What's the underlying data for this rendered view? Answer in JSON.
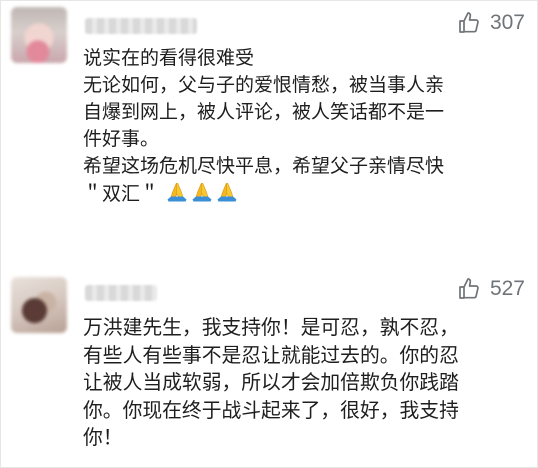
{
  "comments": [
    {
      "likes": "307",
      "lines": [
        "说实在的看得很难受",
        "无论如何，父与子的爱恨情愁，被当事人亲",
        "自爆到网上，被人评论，被人笑话都不是一",
        "件好事。",
        "希望这场危机尽快平息，希望父子亲情尽快",
        "＂双汇＂"
      ],
      "emoji": [
        "folded-hands-icon",
        "folded-hands-icon",
        "folded-hands-icon"
      ]
    },
    {
      "likes": "527",
      "lines": [
        "万洪建先生，我支持你！是可忍，孰不忍，",
        "有些人有些事不是忍让就能过去的。你的忍",
        "让被人当成软弱，所以才会加倍欺负你践踏",
        "你。你现在终于战斗起来了，很好，我支持",
        "你！"
      ]
    }
  ],
  "colors": {
    "text": "#1e1e1e",
    "like_text": "#6f7479",
    "emoji": "#f5b820"
  }
}
